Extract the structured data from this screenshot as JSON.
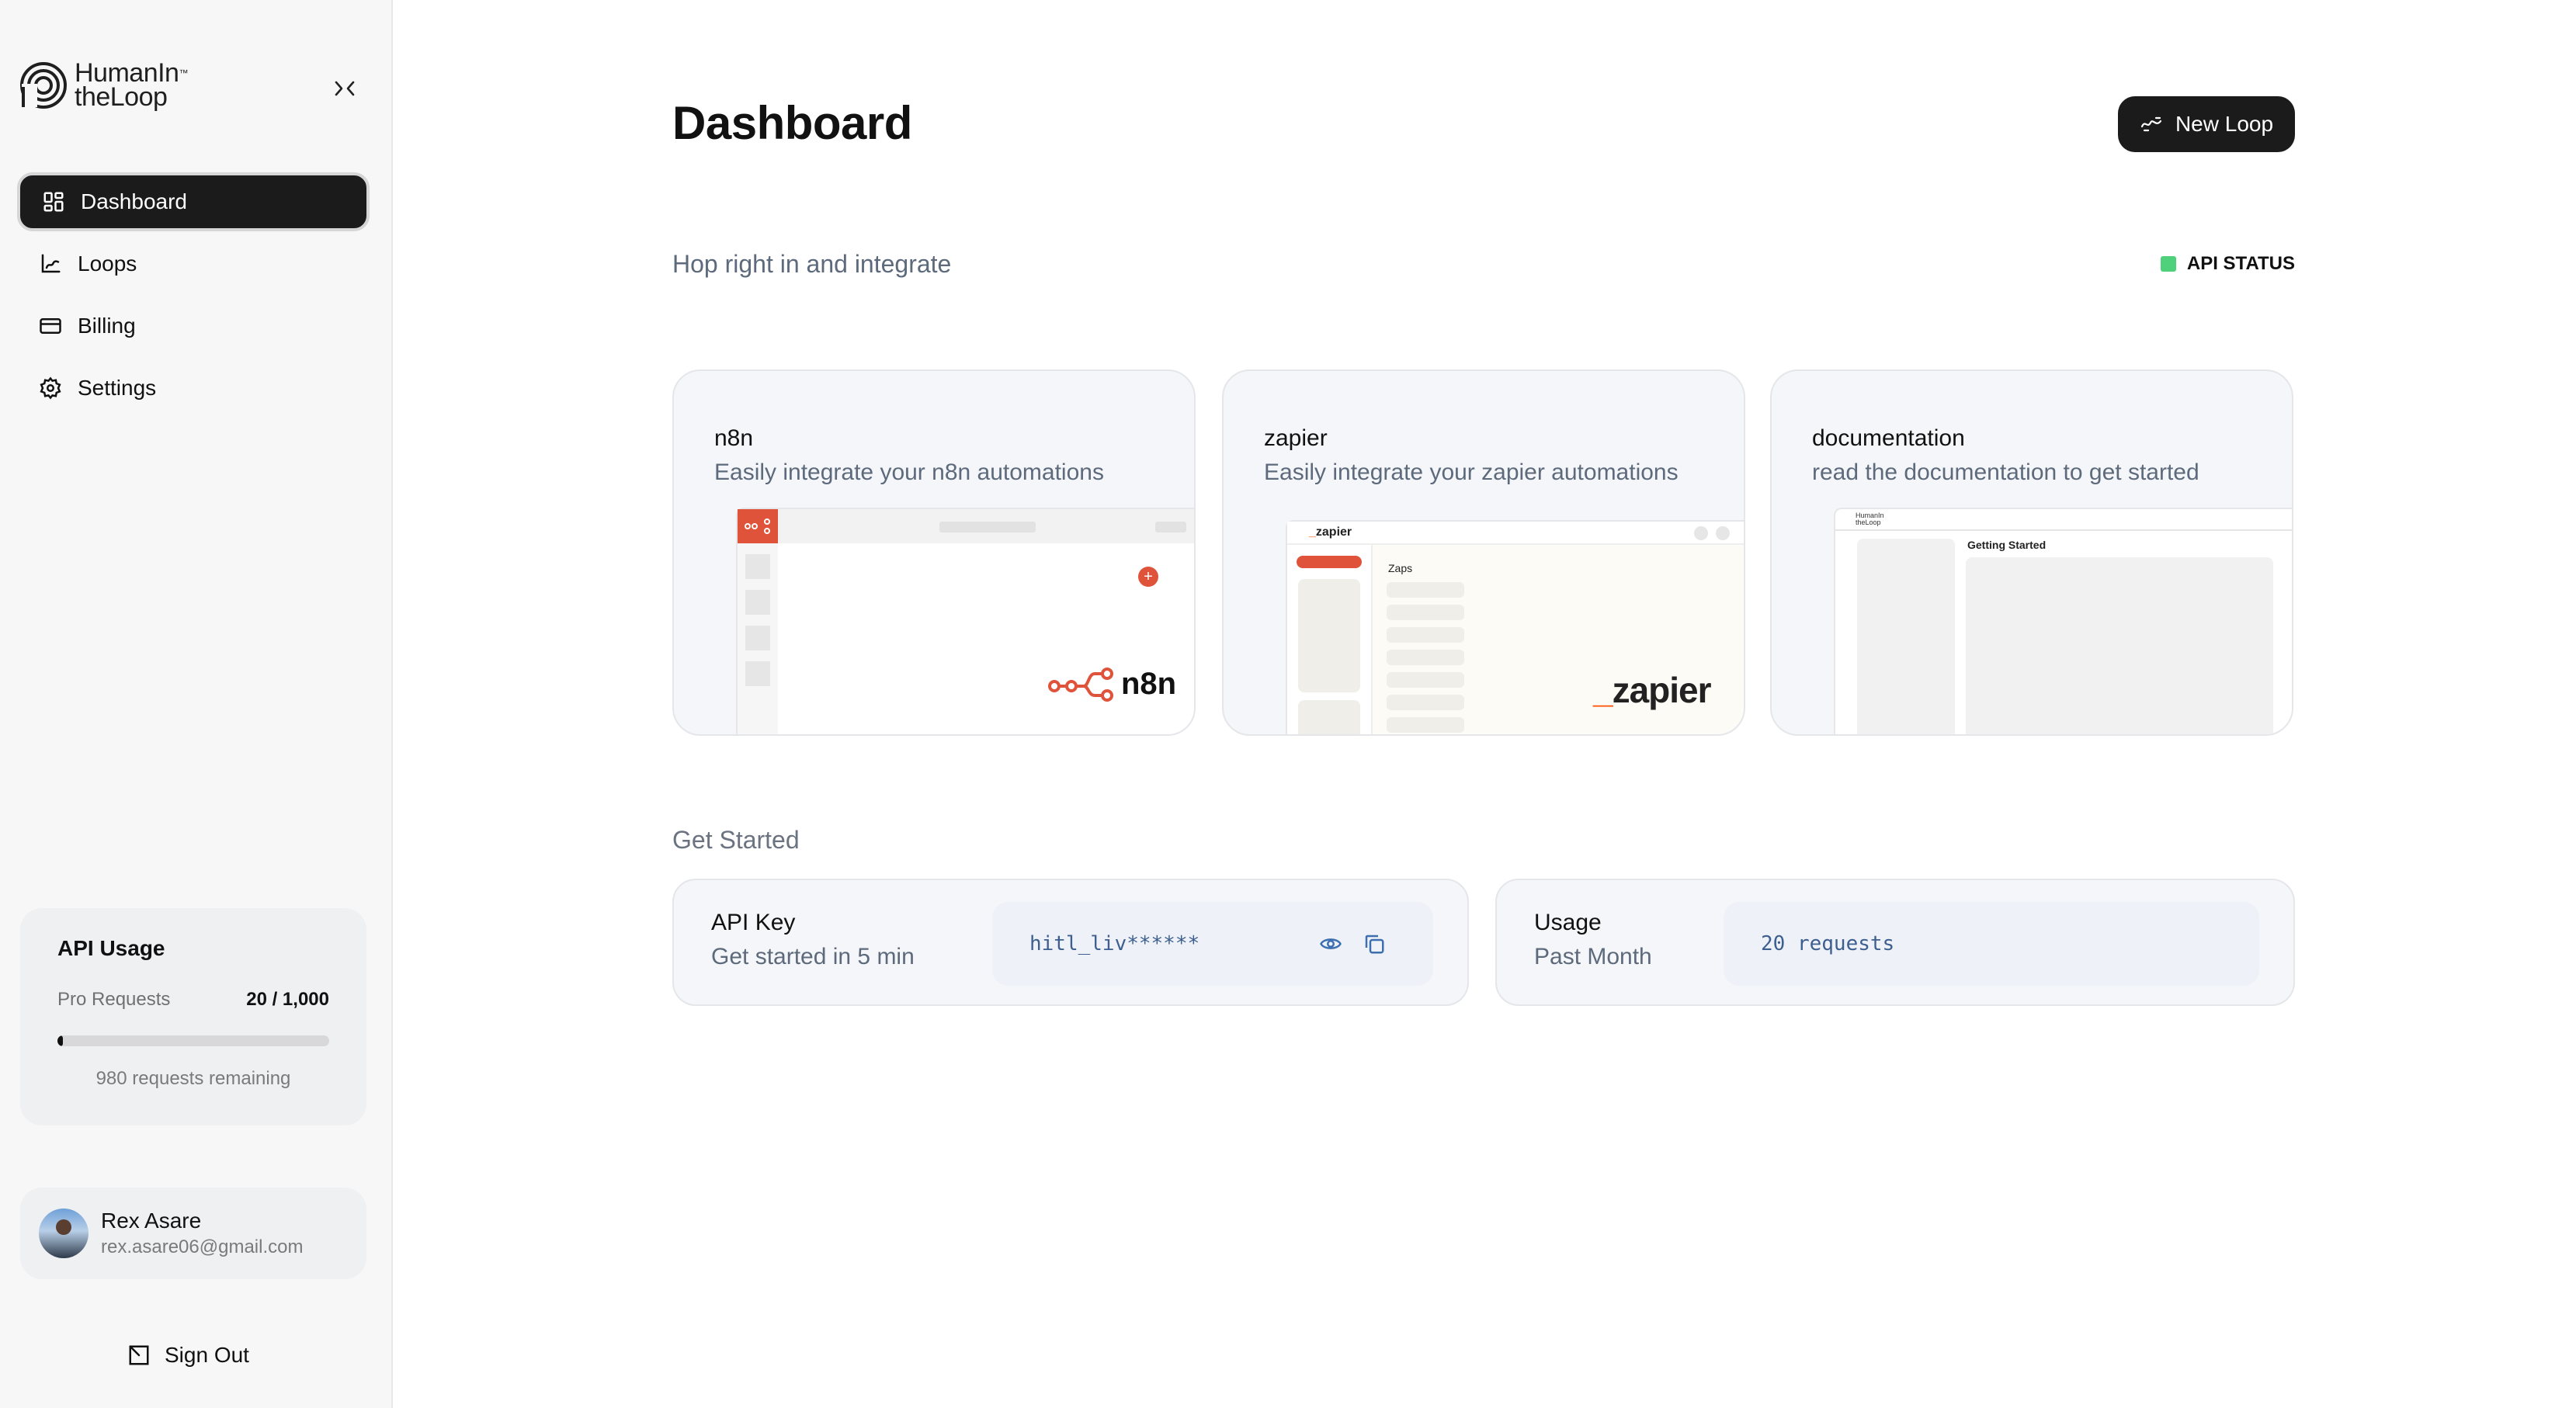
{
  "brand": {
    "line1": "HumanIn",
    "line2": "theLoop",
    "tm": "™"
  },
  "sidebar": {
    "items": [
      {
        "label": "Dashboard",
        "icon": "dashboard-icon",
        "active": true
      },
      {
        "label": "Loops",
        "icon": "loops-icon"
      },
      {
        "label": "Billing",
        "icon": "card-icon"
      },
      {
        "label": "Settings",
        "icon": "gear-icon"
      }
    ]
  },
  "usage": {
    "title": "API Usage",
    "plan_label": "Pro Requests",
    "count": "20 / 1,000",
    "fraction_used": 0.02,
    "remaining": "980 requests remaining"
  },
  "profile": {
    "name": "Rex Asare",
    "email": "rex.asare06@gmail.com"
  },
  "signout_label": "Sign Out",
  "header": {
    "title": "Dashboard",
    "new_loop_label": "New Loop"
  },
  "intro": {
    "text": "Hop right in and integrate",
    "status_label": "API STATUS",
    "status_color": "#4fd07a"
  },
  "integrations": [
    {
      "title": "n8n",
      "desc": "Easily integrate your n8n automations",
      "brand_text": "n8n",
      "brand_color": "#e0533b"
    },
    {
      "title": "zapier",
      "desc": "Easily integrate your zapier automations",
      "brand_text": "zapier",
      "preview_heading": "Zaps",
      "mini_logo": "zapier",
      "brand_color": "#ff4f00"
    },
    {
      "title": "documentation",
      "desc": "read the documentation to get started",
      "preview_heading": "Getting Started",
      "mini_logo_1": "HumanIn",
      "mini_logo_2": "theLoop"
    }
  ],
  "get_started": {
    "title": "Get Started",
    "api_key": {
      "title": "API Key",
      "desc": "Get started in 5 min",
      "value": "hitl_liv******"
    },
    "usage": {
      "title": "Usage",
      "desc": "Past Month",
      "value": "20 requests"
    }
  }
}
